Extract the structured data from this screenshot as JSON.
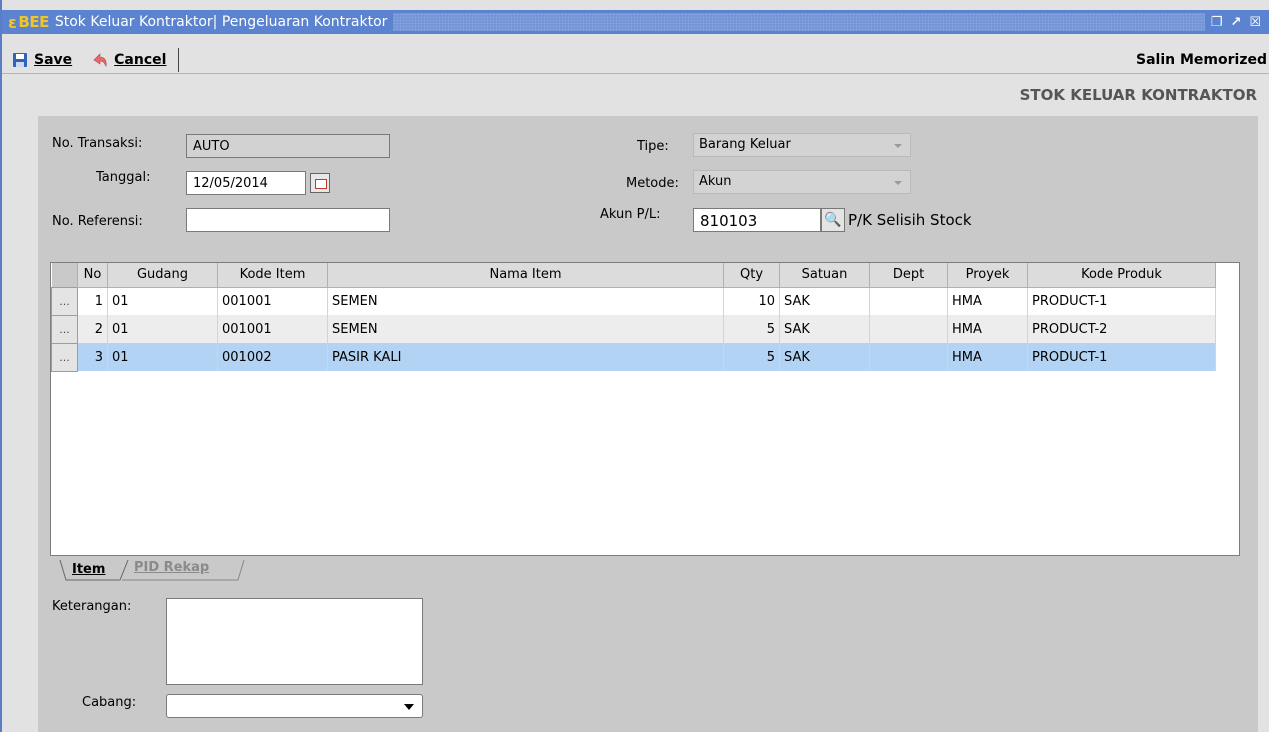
{
  "window": {
    "logo": "BEE",
    "title": "Stok Keluar Kontraktor| Pengeluaran Kontraktor"
  },
  "toolbar": {
    "save_label": "Save",
    "cancel_label": "Cancel",
    "salin_label": "Salin Memorized"
  },
  "header": {
    "section_title": "STOK KELUAR KONTRAKTOR"
  },
  "form": {
    "no_transaksi_label": "No. Transaksi:",
    "no_transaksi_value": "AUTO",
    "tanggal_label": "Tanggal:",
    "tanggal_value": "12/05/2014",
    "no_referensi_label": "No. Referensi:",
    "no_referensi_value": "",
    "tipe_label": "Tipe:",
    "tipe_value": "Barang Keluar",
    "metode_label": "Metode:",
    "metode_value": "Akun",
    "akun_label": "Akun P/L:",
    "akun_value": "810103",
    "akun_desc": "P/K Selisih Stock",
    "keterangan_label": "Keterangan:",
    "keterangan_value": "",
    "cabang_label": "Cabang:",
    "cabang_value": ""
  },
  "grid": {
    "columns": [
      "No",
      "Gudang",
      "Kode Item",
      "Nama Item",
      "Qty",
      "Satuan",
      "Dept",
      "Proyek",
      "Kode Produk"
    ],
    "rows": [
      {
        "no": "1",
        "gudang": "01",
        "kode_item": "001001",
        "nama_item": "SEMEN",
        "qty": "10",
        "satuan": "SAK",
        "dept": "",
        "proyek": "HMA",
        "kode_produk": "PRODUCT-1"
      },
      {
        "no": "2",
        "gudang": "01",
        "kode_item": "001001",
        "nama_item": "SEMEN",
        "qty": "5",
        "satuan": "SAK",
        "dept": "",
        "proyek": "HMA",
        "kode_produk": "PRODUCT-2"
      },
      {
        "no": "3",
        "gudang": "01",
        "kode_item": "001002",
        "nama_item": "PASIR KALI",
        "qty": "5",
        "satuan": "SAK",
        "dept": "",
        "proyek": "HMA",
        "kode_produk": "PRODUCT-1"
      }
    ],
    "row_button": "..."
  },
  "tabs": [
    {
      "label": "Item",
      "active": true
    },
    {
      "label": "PID Rekap",
      "active": false
    }
  ],
  "colors": {
    "titlebar": "#5b83cf",
    "selected_row": "#b2d3f3",
    "logo": "#f3c521"
  }
}
